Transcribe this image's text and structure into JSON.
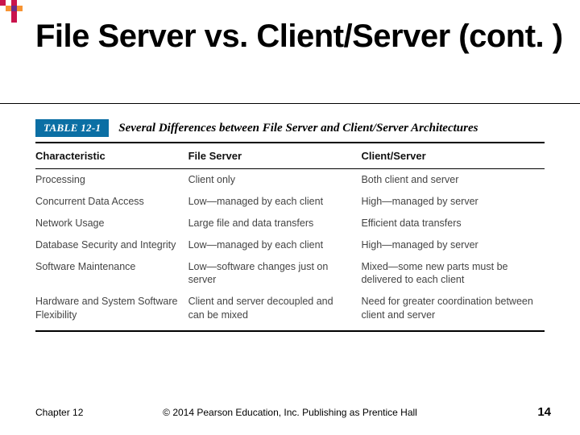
{
  "title": "File Server vs. Client/Server (cont. )",
  "table": {
    "label": "TABLE 12-1",
    "caption": "Several Differences between File Server and Client/Server Architectures",
    "headers": [
      "Characteristic",
      "File Server",
      "Client/Server"
    ],
    "rows": [
      [
        "Processing",
        "Client only",
        "Both client and server"
      ],
      [
        "Concurrent Data Access",
        "Low—managed by each client",
        "High—managed by server"
      ],
      [
        "Network Usage",
        "Large file and data transfers",
        "Efficient data transfers"
      ],
      [
        "Database Security and Integrity",
        "Low—managed by each client",
        "High—managed by server"
      ],
      [
        "Software Maintenance",
        "Low—software changes just on server",
        "Mixed—some new parts must be delivered to each client"
      ],
      [
        "Hardware and System Software Flexibility",
        "Client and server decoupled and can be mixed",
        "Need for greater coordination between client and server"
      ]
    ]
  },
  "footer": {
    "chapter": "Chapter 12",
    "copyright": "© 2014 Pearson Education, Inc. Publishing as Prentice Hall",
    "page": "14"
  }
}
